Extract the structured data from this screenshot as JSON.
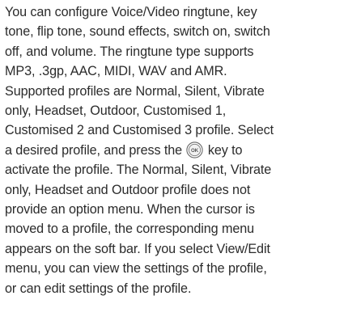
{
  "paragraph": {
    "line1": "You can configure Voice/Video ringtune, key",
    "line2": "tone, flip tone, sound effects, switch on, switch",
    "line3": "off, and volume. The ringtune type supports",
    "line4": "MP3, .3gp, AAC, MIDI, WAV and AMR.",
    "line5": "Supported profiles are Normal, Silent, Vibrate",
    "line6": "only, Headset, Outdoor, Customised 1,",
    "line7": "Customised 2 and Customised 3 profile. Select",
    "line8_before": "a desired profile, and press the ",
    "line8_after": " key to",
    "line9": "activate the profile. The Normal, Silent, Vibrate",
    "line10": "only, Headset and Outdoor profile does not",
    "line11": "provide an option menu. When the cursor is",
    "line12": "moved to a profile, the corresponding menu",
    "line13": "appears on the soft bar. If you select View/Edit",
    "line14": "menu, you can view the settings of the profile,",
    "line15": "or can edit settings of the profile."
  },
  "ok_key": {
    "icon": "ok-key-icon",
    "label": "OK",
    "color": "#555555"
  }
}
